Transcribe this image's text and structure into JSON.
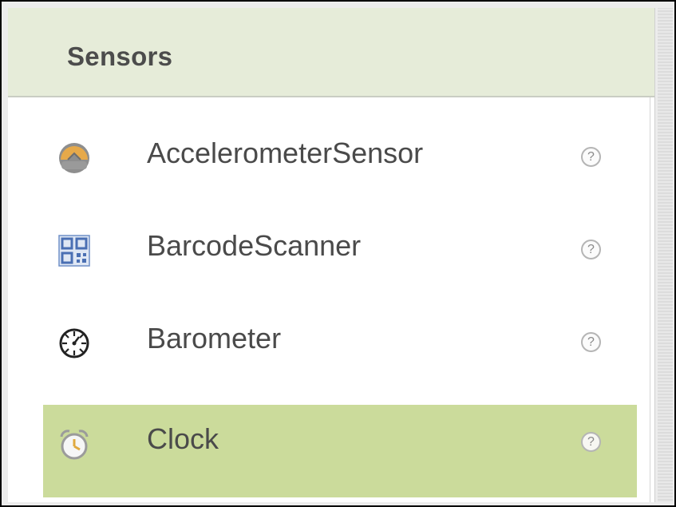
{
  "panel": {
    "title": "Sensors"
  },
  "items": [
    {
      "label": "AccelerometerSensor",
      "icon": "accelerometer-icon",
      "help": "?",
      "selected": false
    },
    {
      "label": "BarcodeScanner",
      "icon": "barcode-scanner-icon",
      "help": "?",
      "selected": false
    },
    {
      "label": "Barometer",
      "icon": "barometer-icon",
      "help": "?",
      "selected": false
    },
    {
      "label": "Clock",
      "icon": "clock-icon",
      "help": "?",
      "selected": true
    }
  ],
  "colors": {
    "header_background": "#e6ecd9",
    "selected_background": "#cbdb9b",
    "text": "#4a4a4a"
  }
}
